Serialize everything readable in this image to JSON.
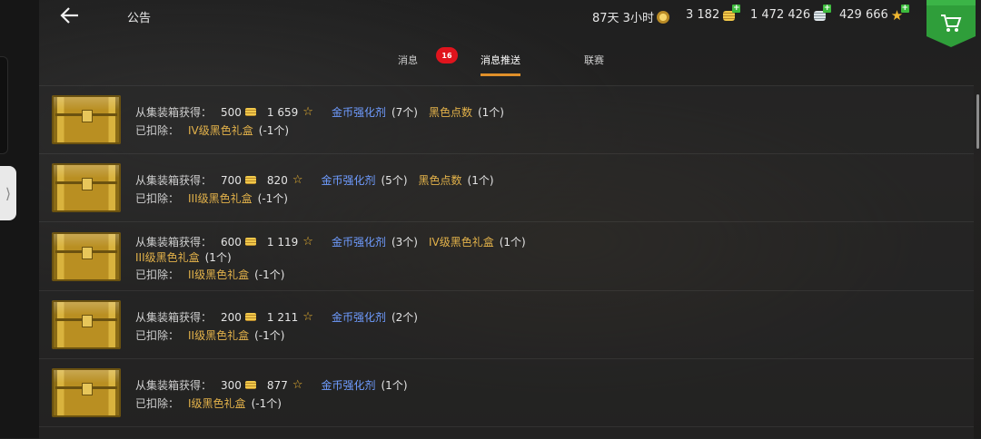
{
  "header": {
    "title": "公告",
    "premium_time": "87天 3小时",
    "gold": "3 182",
    "credits": "1 472 426",
    "free_xp": "429 666"
  },
  "tabs": [
    {
      "label": "消息",
      "badge": "16"
    },
    {
      "label": "消息推送"
    },
    {
      "label": "联赛"
    }
  ],
  "rows": [
    {
      "received_label": "从集装箱获得：",
      "gold": "500",
      "xp": "1 659",
      "item1": "金币强化剂",
      "item1_qty": "(7个)",
      "item2": "黑色点数",
      "item2_qty": "(1个)",
      "deducted_label": "已扣除：",
      "deducted_item": "IV级黑色礼盒",
      "deducted_qty": "(-1个)"
    },
    {
      "received_label": "从集装箱获得：",
      "gold": "700",
      "xp": "820",
      "item1": "金币强化剂",
      "item1_qty": "(5个)",
      "item2": "黑色点数",
      "item2_qty": "(1个)",
      "deducted_label": "已扣除：",
      "deducted_item": "III级黑色礼盒",
      "deducted_qty": "(-1个)"
    },
    {
      "received_label": "从集装箱获得：",
      "gold": "600",
      "xp": "1 119",
      "item1": "金币强化剂",
      "item1_qty": "(3个)",
      "item2": "IV级黑色礼盒",
      "item2_qty": "(1个)",
      "item3": "III级黑色礼盒",
      "item3_qty": "(1个)",
      "deducted_label": "已扣除：",
      "deducted_item": "II级黑色礼盒",
      "deducted_qty": "(-1个)"
    },
    {
      "received_label": "从集装箱获得：",
      "gold": "200",
      "xp": "1 211",
      "item1": "金币强化剂",
      "item1_qty": "(2个)",
      "deducted_label": "已扣除：",
      "deducted_item": "II级黑色礼盒",
      "deducted_qty": "(-1个)"
    },
    {
      "received_label": "从集装箱获得：",
      "gold": "300",
      "xp": "877",
      "item1": "金币强化剂",
      "item1_qty": "(1个)",
      "deducted_label": "已扣除：",
      "deducted_item": "I级黑色礼盒",
      "deducted_qty": "(-1个)"
    }
  ],
  "colors": {
    "accent_orange": "#e0902a",
    "item_blue": "#6f9cff",
    "item_gold": "#e3b24a",
    "badge_red": "#e0141d",
    "shop_green": "#2f9e3a"
  },
  "icons": {
    "back": "arrow-left-icon",
    "premium": "premium-account-icon",
    "gold": "gold-coin-icon",
    "credits": "silver-credits-icon",
    "xp": "star-icon",
    "shop": "shopping-cart-icon"
  }
}
